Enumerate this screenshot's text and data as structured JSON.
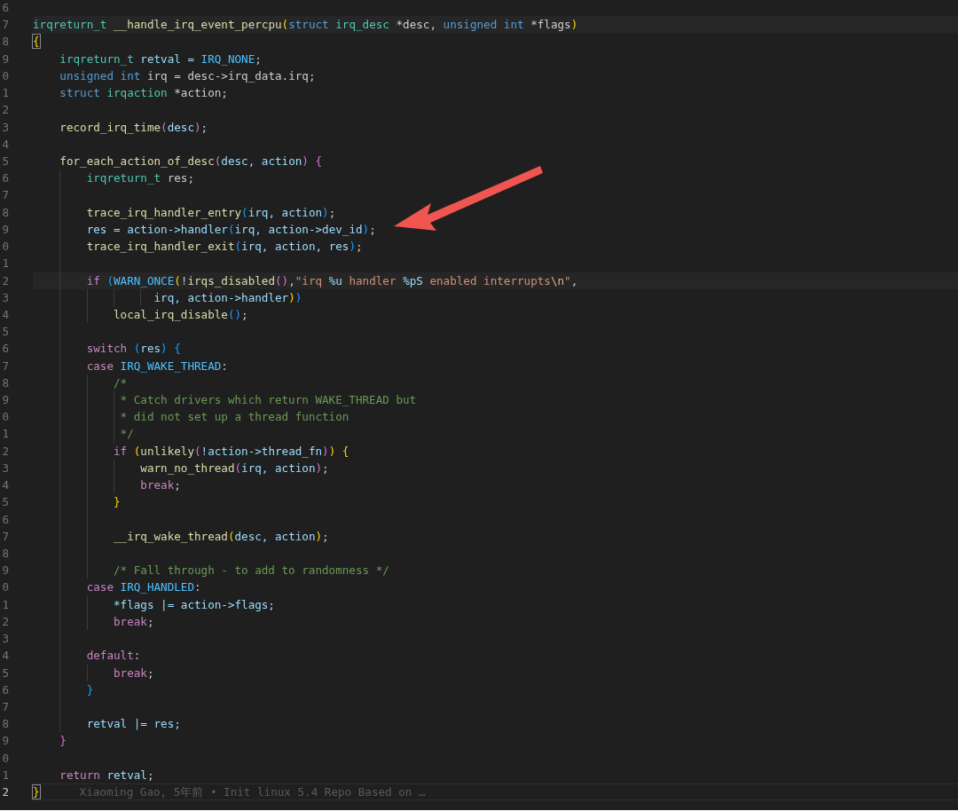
{
  "editor": {
    "lines": [
      {
        "number": "6",
        "highlighted": false,
        "current": false
      },
      {
        "number": "7",
        "highlighted": true,
        "current": false,
        "tokens": [
          {
            "text": "irqreturn_t ",
            "kind": "type"
          },
          {
            "text": "__handle_irq_event_percpu",
            "kind": "fn"
          },
          {
            "text": "(",
            "kind": "b1"
          },
          {
            "text": "struct ",
            "kind": "kw"
          },
          {
            "text": "irq_desc",
            "kind": "type"
          },
          {
            "text": " *desc, ",
            "kind": "plain"
          },
          {
            "text": "unsigned int",
            "kind": "kw"
          },
          {
            "text": " *flags",
            "kind": "plain"
          },
          {
            "text": ")",
            "kind": "b1"
          }
        ]
      },
      {
        "number": "8",
        "highlighted": false,
        "current": false,
        "tokens": [
          {
            "text": "{",
            "kind": "match"
          }
        ]
      },
      {
        "number": "9",
        "highlighted": false,
        "current": false,
        "tokens": [
          {
            "text": "    irqreturn_t",
            "kind": "type"
          },
          {
            "text": " retval = ",
            "kind": "var"
          },
          {
            "text": "IRQ_NONE",
            "kind": "const"
          },
          {
            "text": ";",
            "kind": "plain"
          }
        ]
      },
      {
        "number": "0",
        "highlighted": false,
        "current": false,
        "tokens": [
          {
            "text": "    unsigned int",
            "kind": "kw"
          },
          {
            "text": " irq = desc->irq_data.irq;",
            "kind": "plain"
          }
        ]
      },
      {
        "number": "1",
        "highlighted": false,
        "current": false,
        "tokens": [
          {
            "text": "    struct ",
            "kind": "kw"
          },
          {
            "text": "irqaction",
            "kind": "type"
          },
          {
            "text": " *action;",
            "kind": "plain"
          }
        ]
      },
      {
        "number": "2",
        "highlighted": false,
        "current": false
      },
      {
        "number": "3",
        "highlighted": false,
        "current": false,
        "tokens": [
          {
            "text": "    record_irq_time",
            "kind": "fn"
          },
          {
            "text": "(",
            "kind": "b2"
          },
          {
            "text": "desc",
            "kind": "var"
          },
          {
            "text": ")",
            "kind": "b2"
          },
          {
            "text": ";",
            "kind": "plain"
          }
        ]
      },
      {
        "number": "4",
        "highlighted": false,
        "current": false
      },
      {
        "number": "5",
        "highlighted": false,
        "current": false,
        "tokens": [
          {
            "text": "    for_each_action_of_desc",
            "kind": "macro"
          },
          {
            "text": "(",
            "kind": "b2"
          },
          {
            "text": "desc, action",
            "kind": "var"
          },
          {
            "text": ") {",
            "kind": "b2"
          }
        ]
      },
      {
        "number": "6",
        "highlighted": false,
        "current": false,
        "tokens": [
          {
            "text": "        irqreturn_t",
            "kind": "type"
          },
          {
            "text": " res;",
            "kind": "plain"
          }
        ]
      },
      {
        "number": "7",
        "highlighted": false,
        "current": false
      },
      {
        "number": "8",
        "highlighted": false,
        "current": false,
        "tokens": [
          {
            "text": "        trace_irq_handler_entry",
            "kind": "fn"
          },
          {
            "text": "(",
            "kind": "b3"
          },
          {
            "text": "irq, action",
            "kind": "var"
          },
          {
            "text": ")",
            "kind": "b3"
          },
          {
            "text": ";",
            "kind": "plain"
          }
        ]
      },
      {
        "number": "9",
        "highlighted": false,
        "current": false,
        "tokens": [
          {
            "text": "        res = action->handler",
            "kind": "var"
          },
          {
            "text": "(",
            "kind": "b3"
          },
          {
            "text": "irq, action->dev_id",
            "kind": "var"
          },
          {
            "text": ")",
            "kind": "b3"
          },
          {
            "text": ";",
            "kind": "plain"
          }
        ]
      },
      {
        "number": "0",
        "highlighted": false,
        "current": false,
        "tokens": [
          {
            "text": "        trace_irq_handler_exit",
            "kind": "fn"
          },
          {
            "text": "(",
            "kind": "b3"
          },
          {
            "text": "irq, action, res",
            "kind": "var"
          },
          {
            "text": ")",
            "kind": "b3"
          },
          {
            "text": ";",
            "kind": "plain"
          }
        ]
      },
      {
        "number": "1",
        "highlighted": false,
        "current": false
      },
      {
        "number": "2",
        "highlighted": true,
        "current": false,
        "tokens": [
          {
            "text": "        if ",
            "kind": "ctrl"
          },
          {
            "text": "(",
            "kind": "b3"
          },
          {
            "text": "WARN_ONCE",
            "kind": "const"
          },
          {
            "text": "(",
            "kind": "b1"
          },
          {
            "text": "!",
            "kind": "plain"
          },
          {
            "text": "irqs_disabled",
            "kind": "fn"
          },
          {
            "text": "()",
            "kind": "b2"
          },
          {
            "text": ",",
            "kind": "plain"
          },
          {
            "text": "\"irq ",
            "kind": "str"
          },
          {
            "text": "%u",
            "kind": "var"
          },
          {
            "text": " handler ",
            "kind": "str"
          },
          {
            "text": "%pS",
            "kind": "var"
          },
          {
            "text": " enabled interrupts",
            "kind": "str"
          },
          {
            "text": "\\n",
            "kind": "esc"
          },
          {
            "text": "\"",
            "kind": "str"
          },
          {
            "text": ",",
            "kind": "plain"
          }
        ]
      },
      {
        "number": "3",
        "highlighted": false,
        "current": false,
        "tokens": [
          {
            "text": "                  irq, action->handler",
            "kind": "var"
          },
          {
            "text": ")",
            "kind": "b1"
          },
          {
            "text": ")",
            "kind": "b3"
          }
        ]
      },
      {
        "number": "4",
        "highlighted": false,
        "current": false,
        "tokens": [
          {
            "text": "            local_irq_disable",
            "kind": "macro"
          },
          {
            "text": "()",
            "kind": "b3"
          },
          {
            "text": ";",
            "kind": "plain"
          }
        ]
      },
      {
        "number": "5",
        "highlighted": false,
        "current": false
      },
      {
        "number": "6",
        "highlighted": false,
        "current": false,
        "tokens": [
          {
            "text": "        switch ",
            "kind": "ctrl"
          },
          {
            "text": "(",
            "kind": "b3"
          },
          {
            "text": "res",
            "kind": "var"
          },
          {
            "text": ") {",
            "kind": "b3"
          }
        ]
      },
      {
        "number": "7",
        "highlighted": false,
        "current": false,
        "tokens": [
          {
            "text": "        case ",
            "kind": "ctrl"
          },
          {
            "text": "IRQ_WAKE_THREAD",
            "kind": "const"
          },
          {
            "text": ":",
            "kind": "plain"
          }
        ]
      },
      {
        "number": "8",
        "highlighted": false,
        "current": false,
        "tokens": [
          {
            "text": "            /*",
            "kind": "cmt"
          }
        ]
      },
      {
        "number": "9",
        "highlighted": false,
        "current": false,
        "tokens": [
          {
            "text": "             * Catch drivers which return WAKE_THREAD but",
            "kind": "cmt"
          }
        ]
      },
      {
        "number": "0",
        "highlighted": false,
        "current": false,
        "tokens": [
          {
            "text": "             * did not set up a thread function",
            "kind": "cmt"
          }
        ]
      },
      {
        "number": "1",
        "highlighted": false,
        "current": false,
        "tokens": [
          {
            "text": "             */",
            "kind": "cmt"
          }
        ]
      },
      {
        "number": "2",
        "highlighted": false,
        "current": false,
        "tokens": [
          {
            "text": "            if ",
            "kind": "ctrl"
          },
          {
            "text": "(",
            "kind": "b1"
          },
          {
            "text": "unlikely",
            "kind": "macro"
          },
          {
            "text": "(",
            "kind": "b2"
          },
          {
            "text": "!action->thread_fn",
            "kind": "var"
          },
          {
            "text": ")",
            "kind": "b2"
          },
          {
            "text": ") {",
            "kind": "b1"
          }
        ]
      },
      {
        "number": "3",
        "highlighted": false,
        "current": false,
        "tokens": [
          {
            "text": "                warn_no_thread",
            "kind": "fn"
          },
          {
            "text": "(",
            "kind": "b2"
          },
          {
            "text": "irq, action",
            "kind": "var"
          },
          {
            "text": ")",
            "kind": "b2"
          },
          {
            "text": ";",
            "kind": "plain"
          }
        ]
      },
      {
        "number": "4",
        "highlighted": false,
        "current": false,
        "tokens": [
          {
            "text": "                break",
            "kind": "ctrl"
          },
          {
            "text": ";",
            "kind": "plain"
          }
        ]
      },
      {
        "number": "5",
        "highlighted": false,
        "current": false,
        "tokens": [
          {
            "text": "            }",
            "kind": "b1"
          }
        ]
      },
      {
        "number": "6",
        "highlighted": false,
        "current": false
      },
      {
        "number": "7",
        "highlighted": false,
        "current": false,
        "tokens": [
          {
            "text": "            __irq_wake_thread",
            "kind": "fn"
          },
          {
            "text": "(",
            "kind": "b1"
          },
          {
            "text": "desc, action",
            "kind": "var"
          },
          {
            "text": ")",
            "kind": "b1"
          },
          {
            "text": ";",
            "kind": "plain"
          }
        ]
      },
      {
        "number": "8",
        "highlighted": false,
        "current": false
      },
      {
        "number": "9",
        "highlighted": false,
        "current": false,
        "tokens": [
          {
            "text": "            /* Fall through - to add to randomness */",
            "kind": "cmt"
          }
        ]
      },
      {
        "number": "0",
        "highlighted": false,
        "current": false,
        "tokens": [
          {
            "text": "        case ",
            "kind": "ctrl"
          },
          {
            "text": "IRQ_HANDLED",
            "kind": "const"
          },
          {
            "text": ":",
            "kind": "plain"
          }
        ]
      },
      {
        "number": "1",
        "highlighted": false,
        "current": false,
        "tokens": [
          {
            "text": "            *flags |= action->flags;",
            "kind": "var"
          }
        ]
      },
      {
        "number": "2",
        "highlighted": false,
        "current": false,
        "tokens": [
          {
            "text": "            break",
            "kind": "ctrl"
          },
          {
            "text": ";",
            "kind": "plain"
          }
        ]
      },
      {
        "number": "3",
        "highlighted": false,
        "current": false
      },
      {
        "number": "4",
        "highlighted": false,
        "current": false,
        "tokens": [
          {
            "text": "        default",
            "kind": "ctrl"
          },
          {
            "text": ":",
            "kind": "plain"
          }
        ]
      },
      {
        "number": "5",
        "highlighted": false,
        "current": false,
        "tokens": [
          {
            "text": "            break",
            "kind": "ctrl"
          },
          {
            "text": ";",
            "kind": "plain"
          }
        ]
      },
      {
        "number": "6",
        "highlighted": false,
        "current": false,
        "tokens": [
          {
            "text": "        }",
            "kind": "b3"
          }
        ]
      },
      {
        "number": "7",
        "highlighted": false,
        "current": false
      },
      {
        "number": "8",
        "highlighted": false,
        "current": false,
        "tokens": [
          {
            "text": "        retval |= res;",
            "kind": "var"
          }
        ]
      },
      {
        "number": "9",
        "highlighted": false,
        "current": false,
        "tokens": [
          {
            "text": "    }",
            "kind": "b2"
          }
        ]
      },
      {
        "number": "0",
        "highlighted": false,
        "current": false
      },
      {
        "number": "1",
        "highlighted": false,
        "current": false,
        "tokens": [
          {
            "text": "    return ",
            "kind": "ctrl"
          },
          {
            "text": "retval",
            "kind": "var"
          },
          {
            "text": ";",
            "kind": "plain"
          }
        ]
      },
      {
        "number": "2",
        "highlighted": false,
        "current": true,
        "tokens": [
          {
            "text": "}",
            "kind": "match"
          }
        ],
        "blame": "Xiaoming Gao, 5年前 • Init linux 5.4 Repo Based on …"
      }
    ]
  }
}
